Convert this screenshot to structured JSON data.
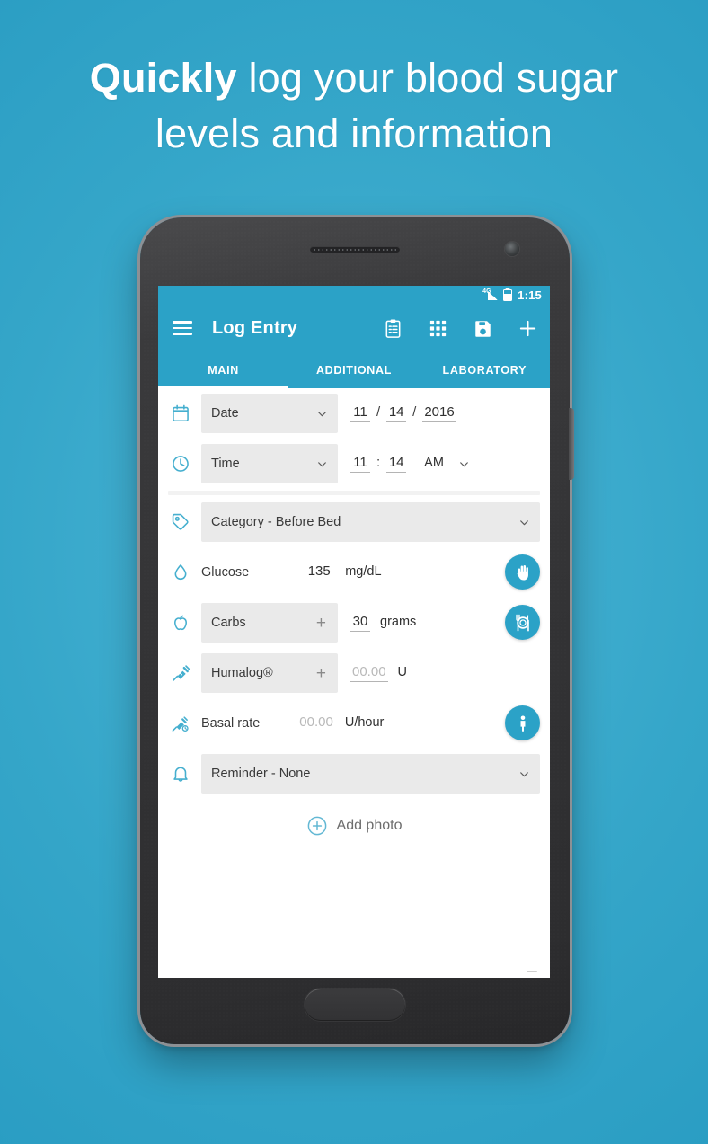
{
  "headline": {
    "strong": "Quickly",
    "rest": " log your blood sugar",
    "line2": "levels and information"
  },
  "statusbar": {
    "network": "4G",
    "time": "1:15"
  },
  "appbar": {
    "title": "Log Entry",
    "menu_icon": "hamburger-menu-icon",
    "actions": [
      {
        "name": "clipboard-icon",
        "label": "Notes"
      },
      {
        "name": "calculator-icon",
        "label": "Calculator"
      },
      {
        "name": "save-icon",
        "label": "Save"
      },
      {
        "name": "plus-icon",
        "label": "Add"
      }
    ]
  },
  "tabs": [
    {
      "label": "MAIN",
      "active": true
    },
    {
      "label": "ADDITIONAL",
      "active": false
    },
    {
      "label": "LABORATORY",
      "active": false
    }
  ],
  "form": {
    "date": {
      "icon": "calendar-icon",
      "label": "Date",
      "month": "11",
      "day": "14",
      "year": "2016",
      "sep": "/"
    },
    "time": {
      "icon": "clock-icon",
      "label": "Time",
      "hour": "11",
      "minute": "14",
      "sep": ":",
      "meridiem": "AM"
    },
    "category": {
      "icon": "tag-icon",
      "label": "Category - Before Bed"
    },
    "glucose": {
      "icon": "droplet-icon",
      "label": "Glucose",
      "value": "135",
      "unit": "mg/dL",
      "fab": "hand-icon"
    },
    "carbs": {
      "icon": "apple-icon",
      "label": "Carbs",
      "add": "+",
      "value": "30",
      "unit": "grams",
      "fab": "meal-icon"
    },
    "humalog": {
      "icon": "syringe-icon",
      "label": "Humalog®",
      "add": "+",
      "value": "00.00",
      "unit": "U"
    },
    "basal": {
      "icon": "syringe-clock-icon",
      "label": "Basal rate",
      "value": "00.00",
      "unit": "U/hour",
      "fab": "person-icon"
    },
    "reminder": {
      "icon": "bell-icon",
      "label": "Reminder - None"
    },
    "add_photo": {
      "icon": "circle-plus-icon",
      "label": "Add photo"
    }
  },
  "navbar": [
    {
      "name": "nav-back-icon"
    },
    {
      "name": "nav-home-icon"
    },
    {
      "name": "nav-recents-icon"
    }
  ],
  "colors": {
    "accent": "#2ba2c7",
    "background_start": "#4cb6d6",
    "background_end": "#229ac2",
    "field_bg": "#eaeaea"
  }
}
